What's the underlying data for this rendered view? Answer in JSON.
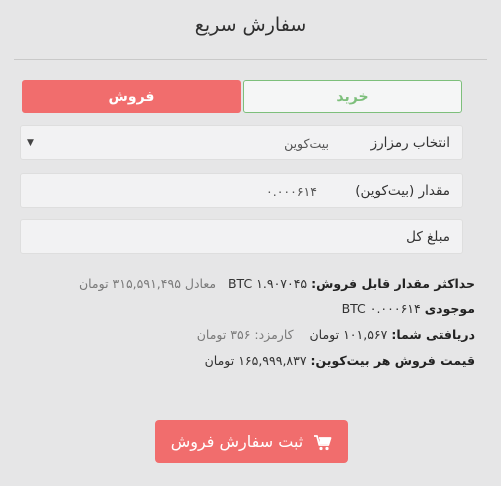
{
  "title": "سفارش سریع",
  "tabs": {
    "sell": "فروش",
    "buy": "خرید"
  },
  "currency_select": {
    "label": "انتخاب رمزارز",
    "value": "بیت‌کوین"
  },
  "amount_field": {
    "label": "مقدار (بیت‌کوین)",
    "value": "۰.۰۰۰۶۱۴"
  },
  "total_field": {
    "label": "مبلغ کل"
  },
  "info": {
    "max_label": "حداکثر مقدار قابل فروش:",
    "max_value": "BTC ۱.۹۰۷۰۴۵",
    "max_equiv": "معادل ۳۱۵,۵۹۱,۴۹۵ تومان",
    "balance_label": "موجودی",
    "balance_value": "BTC ۰.۰۰۰۶۱۴",
    "receive_label": "دریافتی شما:",
    "receive_value": "۱۰۱,۵۶۷ تومان",
    "fee": "کارمزد: ۳۵۶ تومان",
    "price_label": "قیمت فروش هر بیت‌کوین:",
    "price_value": "۱۶۵,۹۹۹,۸۳۷ تومان"
  },
  "submit": {
    "label": "ثبت سفارش فروش",
    "icon": "cart-icon"
  },
  "colors": {
    "sell": "#f16d6d",
    "buy": "#7dbf7b",
    "background": "#e6e6e7"
  }
}
